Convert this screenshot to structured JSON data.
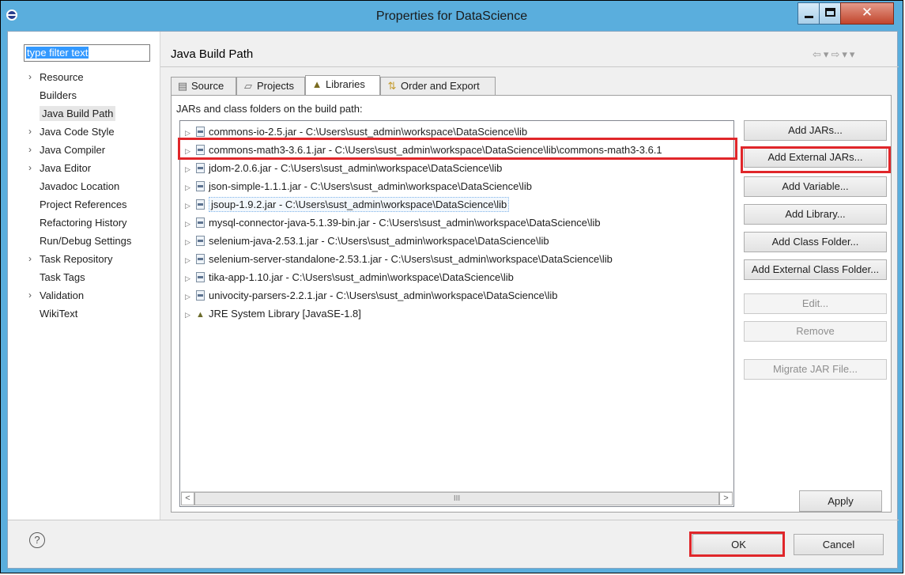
{
  "window": {
    "title": "Properties for DataScience"
  },
  "filter": {
    "text": "type filter text"
  },
  "tree": [
    {
      "label": "Resource",
      "expandable": true
    },
    {
      "label": "Builders",
      "expandable": false
    },
    {
      "label": "Java Build Path",
      "expandable": false,
      "selected": true
    },
    {
      "label": "Java Code Style",
      "expandable": true
    },
    {
      "label": "Java Compiler",
      "expandable": true
    },
    {
      "label": "Java Editor",
      "expandable": true
    },
    {
      "label": "Javadoc Location",
      "expandable": false
    },
    {
      "label": "Project References",
      "expandable": false
    },
    {
      "label": "Refactoring History",
      "expandable": false
    },
    {
      "label": "Run/Debug Settings",
      "expandable": false
    },
    {
      "label": "Task Repository",
      "expandable": true
    },
    {
      "label": "Task Tags",
      "expandable": false
    },
    {
      "label": "Validation",
      "expandable": true
    },
    {
      "label": "WikiText",
      "expandable": false
    }
  ],
  "page": {
    "title": "Java Build Path"
  },
  "tabs": [
    {
      "label": "Source",
      "icon": "source-icon"
    },
    {
      "label": "Projects",
      "icon": "projects-icon"
    },
    {
      "label": "Libraries",
      "icon": "libraries-icon",
      "active": true
    },
    {
      "label": "Order and Export",
      "icon": "order-export-icon"
    }
  ],
  "panel": {
    "label": "JARs and class folders on the build path:"
  },
  "libraries": [
    {
      "text": "commons-io-2.5.jar - C:\\Users\\sust_admin\\workspace\\DataScience\\lib",
      "icon": "jar-icon"
    },
    {
      "text": "commons-math3-3.6.1.jar - C:\\Users\\sust_admin\\workspace\\DataScience\\lib\\commons-math3-3.6.1",
      "icon": "jar-icon",
      "annotated": true
    },
    {
      "text": "jdom-2.0.6.jar - C:\\Users\\sust_admin\\workspace\\DataScience\\lib",
      "icon": "jar-icon"
    },
    {
      "text": "json-simple-1.1.1.jar - C:\\Users\\sust_admin\\workspace\\DataScience\\lib",
      "icon": "jar-icon"
    },
    {
      "text": "jsoup-1.9.2.jar - C:\\Users\\sust_admin\\workspace\\DataScience\\lib",
      "icon": "jar-icon",
      "highlighted": true
    },
    {
      "text": "mysql-connector-java-5.1.39-bin.jar - C:\\Users\\sust_admin\\workspace\\DataScience\\lib",
      "icon": "jar-icon"
    },
    {
      "text": "selenium-java-2.53.1.jar - C:\\Users\\sust_admin\\workspace\\DataScience\\lib",
      "icon": "jar-icon"
    },
    {
      "text": "selenium-server-standalone-2.53.1.jar - C:\\Users\\sust_admin\\workspace\\DataScience\\lib",
      "icon": "jar-icon"
    },
    {
      "text": "tika-app-1.10.jar - C:\\Users\\sust_admin\\workspace\\DataScience\\lib",
      "icon": "jar-icon"
    },
    {
      "text": "univocity-parsers-2.2.1.jar - C:\\Users\\sust_admin\\workspace\\DataScience\\lib",
      "icon": "jar-icon"
    },
    {
      "text": "JRE System Library [JavaSE-1.8]",
      "icon": "library-icon"
    }
  ],
  "scrollbar": {
    "thumb_grip": "III"
  },
  "buttons": {
    "add_jars": "Add JARs...",
    "add_external_jars": "Add External JARs...",
    "add_variable": "Add Variable...",
    "add_library": "Add Library...",
    "add_class_folder": "Add Class Folder...",
    "add_external_class_folder": "Add External Class Folder...",
    "edit": "Edit...",
    "remove": "Remove",
    "migrate_jar": "Migrate JAR File...",
    "apply": "Apply",
    "ok": "OK",
    "cancel": "Cancel",
    "help": "?"
  },
  "colors": {
    "titlebar": "#5aaedd",
    "annotation": "#e0262a",
    "selection": "#3399ff"
  }
}
